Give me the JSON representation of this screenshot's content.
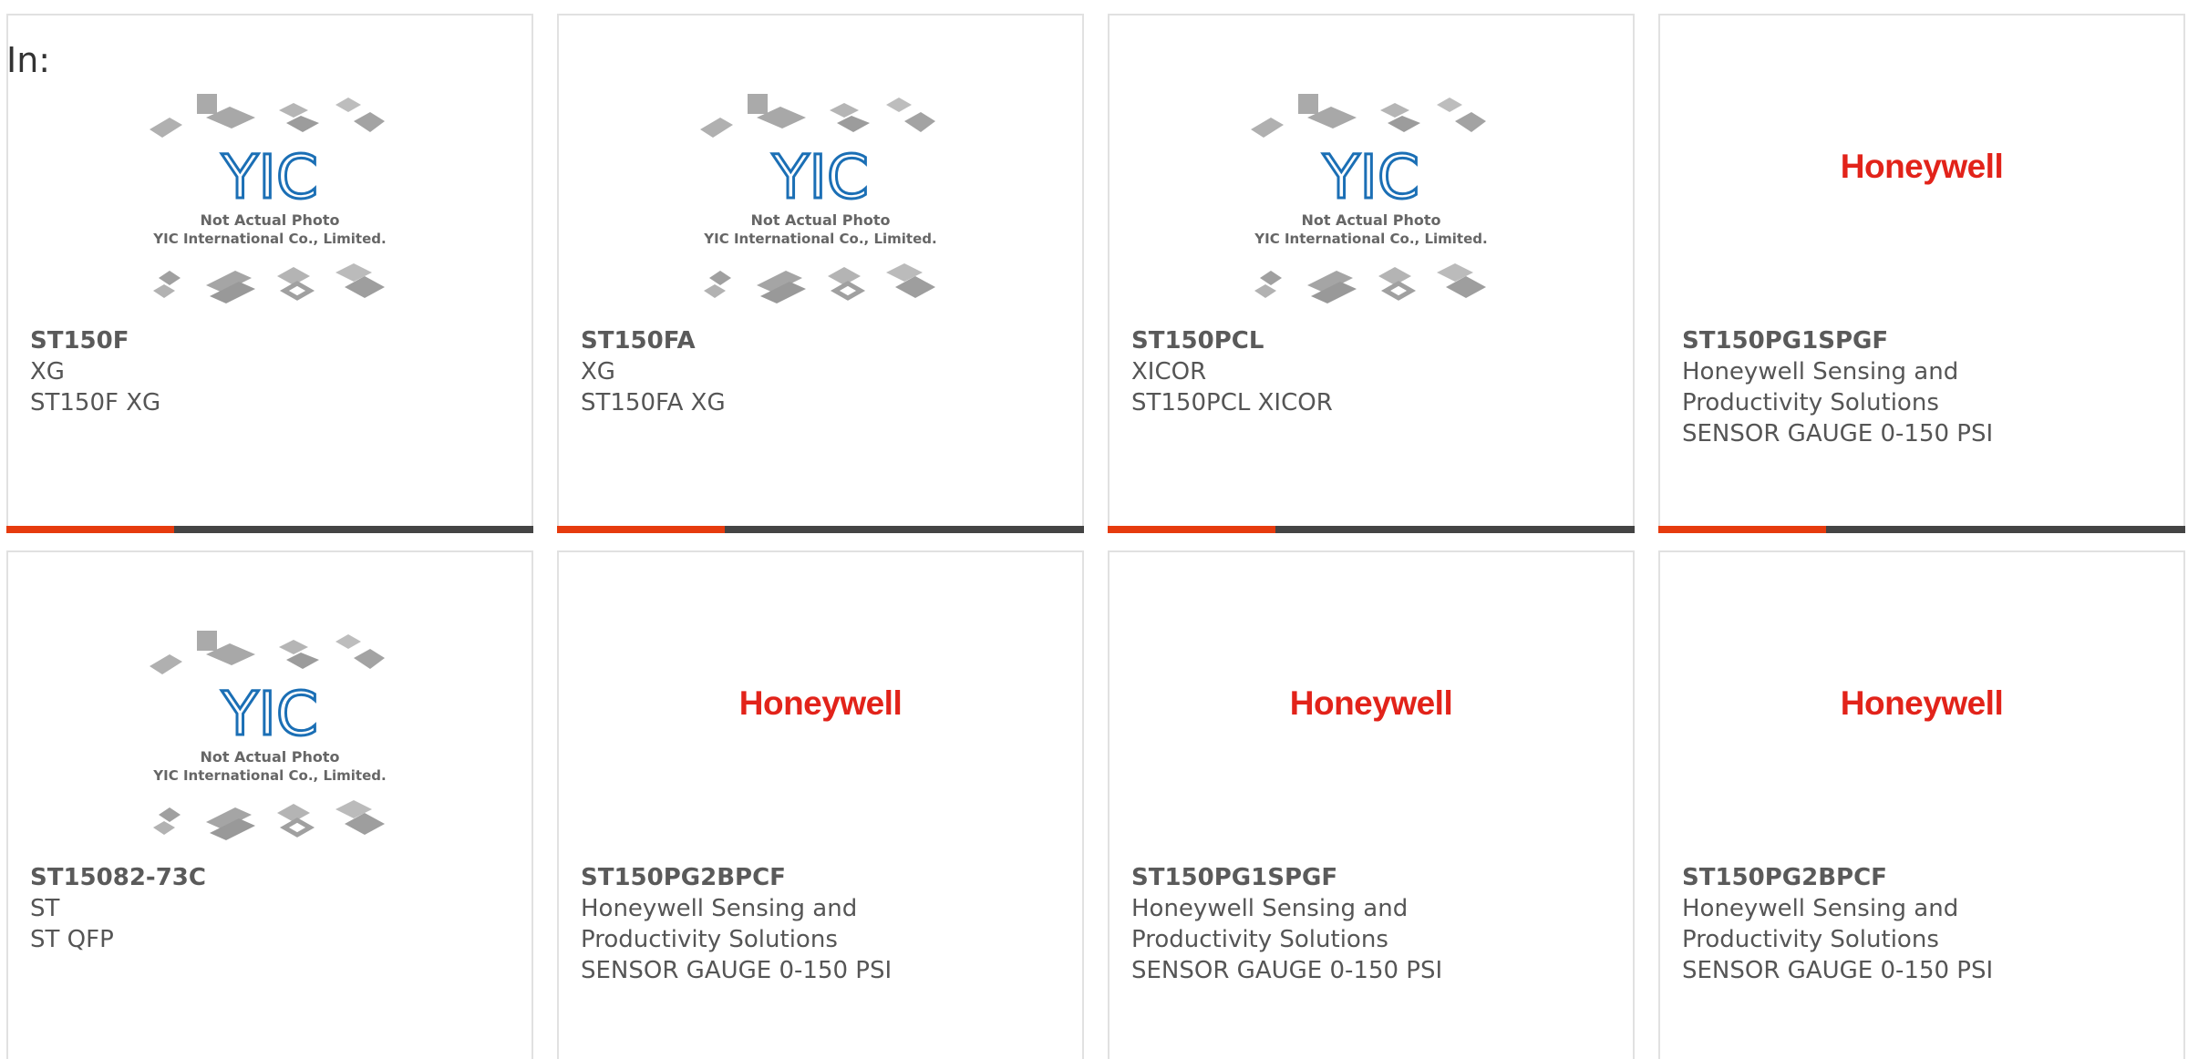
{
  "header": {
    "in_label": "In:"
  },
  "placeholder": {
    "line1": "Not Actual Photo",
    "line2": "YIC International Co., Limited.",
    "logo_text": "YIC"
  },
  "brand": {
    "honeywell": "Honeywell"
  },
  "colors": {
    "accent": "#e63b0e",
    "bar": "#444444",
    "honeywell_red": "#e2231a",
    "yic_blue": "#1b6fb5"
  },
  "cards": [
    {
      "part": "ST150F",
      "mfr": "XG",
      "desc": "ST150F XG",
      "image": "yic-placeholder"
    },
    {
      "part": "ST150FA",
      "mfr": "XG",
      "desc": "ST150FA XG",
      "image": "yic-placeholder"
    },
    {
      "part": "ST150PCL",
      "mfr": "XICOR",
      "desc": "ST150PCL XICOR",
      "image": "yic-placeholder"
    },
    {
      "part": "ST150PG1SPGF",
      "mfr": "Honeywell Sensing and Productivity Solutions",
      "desc": "SENSOR GAUGE 0-150 PSI",
      "image": "honeywell-logo"
    },
    {
      "part": "ST15082-73C",
      "mfr": "ST",
      "desc": "ST QFP",
      "image": "yic-placeholder"
    },
    {
      "part": "ST150PG2BPCF",
      "mfr": "Honeywell Sensing and Productivity Solutions",
      "desc": "SENSOR GAUGE 0-150 PSI",
      "image": "honeywell-logo"
    },
    {
      "part": "ST150PG1SPGF",
      "mfr": "Honeywell Sensing and Productivity Solutions",
      "desc": "SENSOR GAUGE 0-150 PSI",
      "image": "honeywell-logo"
    },
    {
      "part": "ST150PG2BPCF",
      "mfr": "Honeywell Sensing and Productivity Solutions",
      "desc": "SENSOR GAUGE 0-150 PSI",
      "image": "honeywell-logo"
    }
  ]
}
